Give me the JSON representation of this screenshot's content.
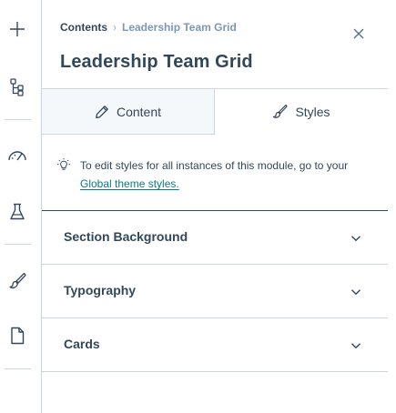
{
  "breadcrumb": {
    "root": "Contents",
    "separator": "›",
    "current": "Leadership Team Grid"
  },
  "title": "Leadership Team Grid",
  "tabs": [
    {
      "label": "Content",
      "icon": "pencil-icon",
      "active": false
    },
    {
      "label": "Styles",
      "icon": "brush-icon",
      "active": true
    }
  ],
  "notice": {
    "icon": "lightbulb-icon",
    "text": "To edit styles for all instances of this module, go to your",
    "link": "Global theme styles."
  },
  "sections": [
    {
      "label": "Section Background"
    },
    {
      "label": "Typography"
    },
    {
      "label": "Cards"
    }
  ],
  "sidebar": [
    {
      "icon": "add-icon"
    },
    {
      "icon": "tree-structure-icon"
    },
    {
      "icon": "gauge-icon"
    },
    {
      "icon": "flask-icon"
    },
    {
      "icon": "paintbrush-icon"
    },
    {
      "icon": "page-icon"
    }
  ],
  "colors": {
    "text": "#33475b",
    "muted": "#7c98b6",
    "link": "#0b7a82",
    "border": "#cbd6e2",
    "tab_inactive_bg": "#f5f8fa"
  }
}
